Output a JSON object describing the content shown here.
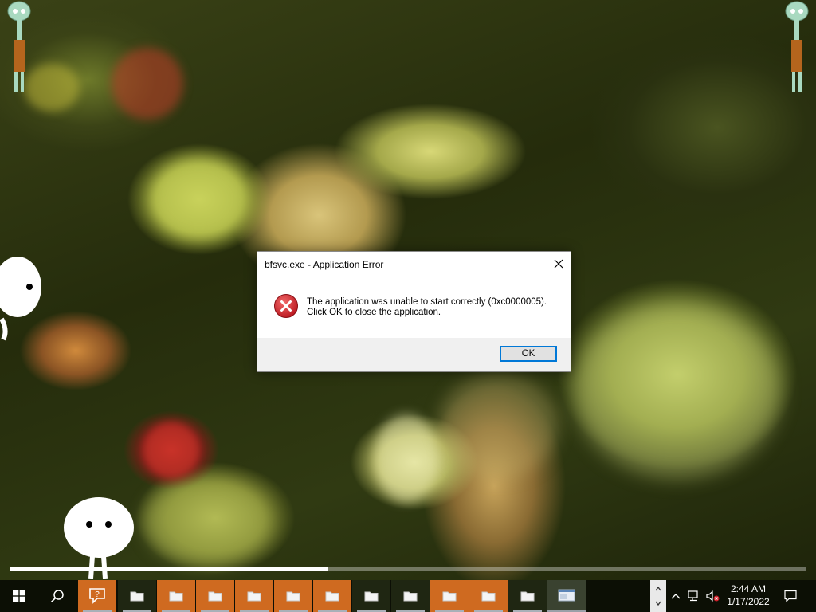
{
  "dialog": {
    "title": "bfsvc.exe - Application Error",
    "message_line1": "The application was unable to start correctly (0xc0000005).",
    "message_line2": "Click OK to close the application.",
    "ok_label": "OK",
    "icon": "error-icon",
    "close_icon": "close-icon"
  },
  "media_progress": {
    "fraction": 0.4
  },
  "taskbar": {
    "start_icon": "windows-logo-icon",
    "search_icon": "search-icon",
    "apps": [
      {
        "name": "help-chat-app",
        "icon": "help-chat-icon",
        "style": "orange"
      },
      {
        "name": "file-explorer-1",
        "icon": "folder-icon",
        "style": "dark"
      },
      {
        "name": "file-explorer-2",
        "icon": "folder-icon",
        "style": "orange"
      },
      {
        "name": "file-explorer-3",
        "icon": "folder-icon",
        "style": "orange"
      },
      {
        "name": "file-explorer-4",
        "icon": "folder-icon",
        "style": "orange"
      },
      {
        "name": "file-explorer-5",
        "icon": "folder-icon",
        "style": "orange"
      },
      {
        "name": "file-explorer-6",
        "icon": "folder-icon",
        "style": "orange"
      },
      {
        "name": "file-explorer-7",
        "icon": "folder-icon",
        "style": "dark"
      },
      {
        "name": "file-explorer-8",
        "icon": "folder-icon",
        "style": "dark"
      },
      {
        "name": "file-explorer-9",
        "icon": "folder-icon",
        "style": "orange"
      },
      {
        "name": "file-explorer-10",
        "icon": "folder-icon",
        "style": "orange"
      },
      {
        "name": "file-explorer-11",
        "icon": "folder-icon",
        "style": "dark"
      },
      {
        "name": "app-window",
        "icon": "window-icon",
        "style": "active"
      }
    ],
    "tray_icons": [
      "chevron-up-icon",
      "network-icon",
      "volume-muted-icon"
    ],
    "clock": {
      "time": "2:44 AM",
      "date": "1/17/2022"
    },
    "notification_icon": "notification-icon"
  },
  "colors": {
    "accent": "#0078d7",
    "taskbar_orange": "#cf6a20",
    "error_red": "#d0202a"
  }
}
